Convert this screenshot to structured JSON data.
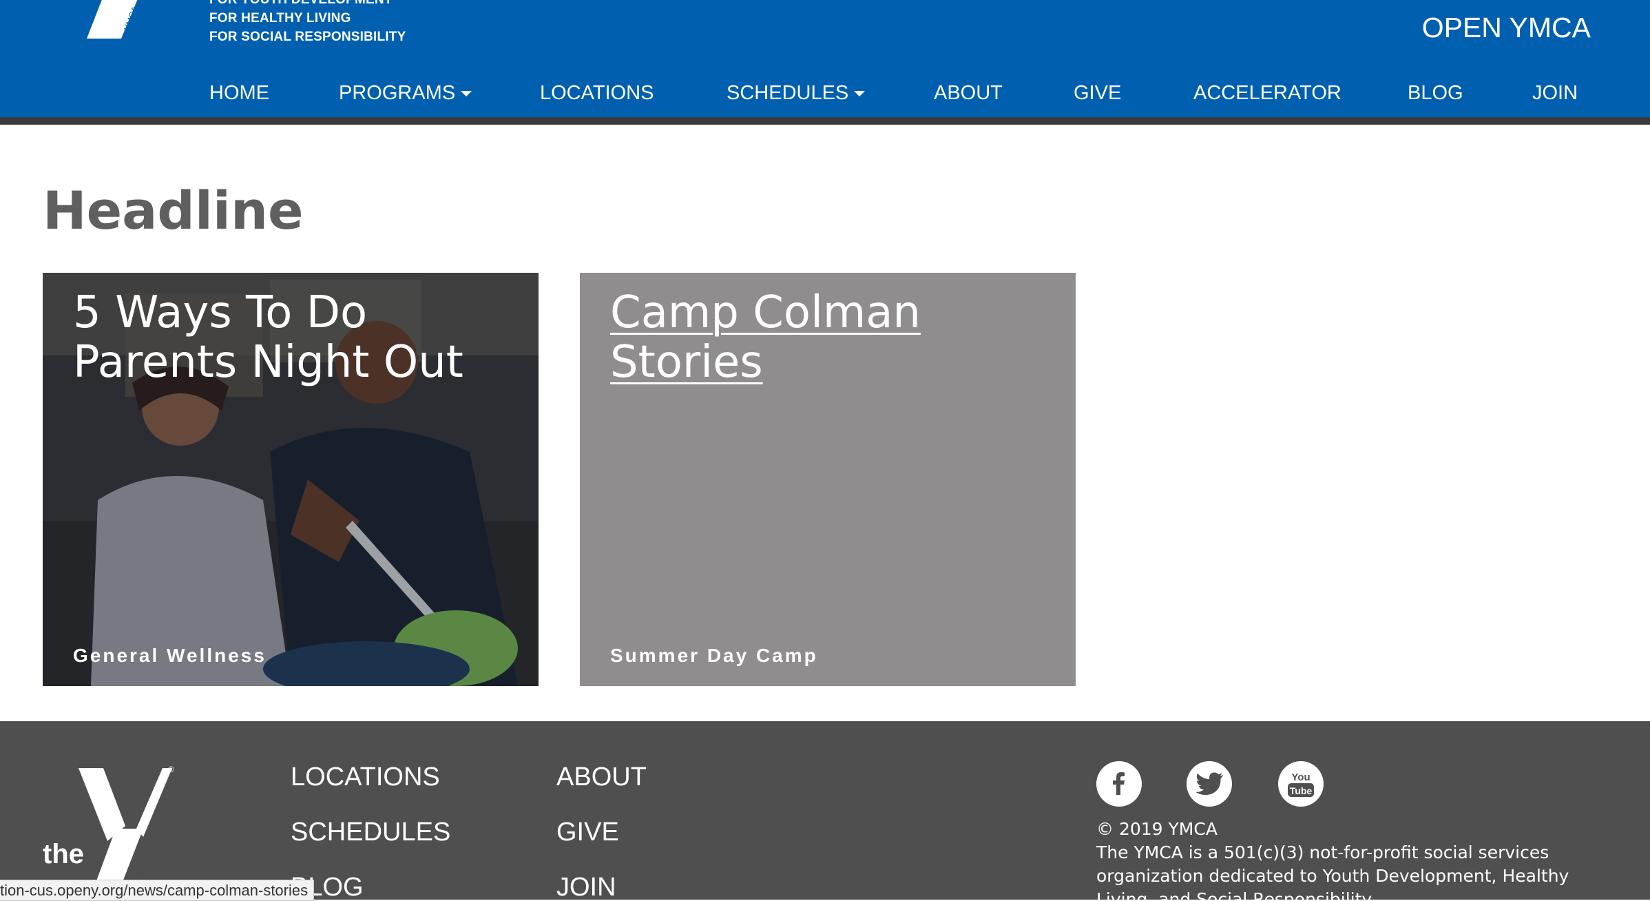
{
  "header": {
    "tagline": [
      "FOR YOUTH DEVELOPMENT",
      "FOR HEALTHY LIVING",
      "FOR SOCIAL RESPONSIBILITY"
    ],
    "site_name": "OPEN YMCA",
    "logo_text": "YMCA",
    "nav": [
      {
        "label": "HOME",
        "has_dropdown": false
      },
      {
        "label": "PROGRAMS",
        "has_dropdown": true
      },
      {
        "label": "LOCATIONS",
        "has_dropdown": false
      },
      {
        "label": "SCHEDULES",
        "has_dropdown": true
      },
      {
        "label": "ABOUT",
        "has_dropdown": false
      },
      {
        "label": "GIVE",
        "has_dropdown": false
      },
      {
        "label": "ACCELERATOR",
        "has_dropdown": false
      },
      {
        "label": "BLOG",
        "has_dropdown": false
      },
      {
        "label": "JOIN",
        "has_dropdown": false
      }
    ]
  },
  "main": {
    "headline": "Headline",
    "cards": [
      {
        "title_line1": "5 Ways To Do",
        "title_line2": "Parents Night Out",
        "category": "General Wellness"
      },
      {
        "title_line1": "Camp Colman",
        "title_line2": "Stories",
        "category": "Summer Day Camp"
      }
    ]
  },
  "footer": {
    "logo_the": "the",
    "logo_text": "YMCA",
    "col1": [
      "LOCATIONS",
      "SCHEDULES",
      "BLOG"
    ],
    "col2": [
      "ABOUT",
      "GIVE",
      "JOIN"
    ],
    "social": [
      {
        "icon": "facebook-icon",
        "label": "f"
      },
      {
        "icon": "twitter-icon",
        "label": ""
      },
      {
        "icon": "youtube-icon",
        "label_top": "You",
        "label_bottom": "Tube"
      }
    ],
    "copyright": "© 2019 YMCA",
    "description": "The YMCA is a 501(c)(3) not-for-profit social services organization dedicated to Youth Development, Healthy Living, and Social Responsibility."
  },
  "status_bar": {
    "url": "tion-cus.openy.org/news/camp-colman-stories"
  },
  "colors": {
    "header_blue": "#0060af",
    "header_stripe": "#3a3a3a",
    "headline_gray": "#5f5f5f",
    "card_gray": "#8f8d8e",
    "footer_gray": "#4f4f4f"
  }
}
